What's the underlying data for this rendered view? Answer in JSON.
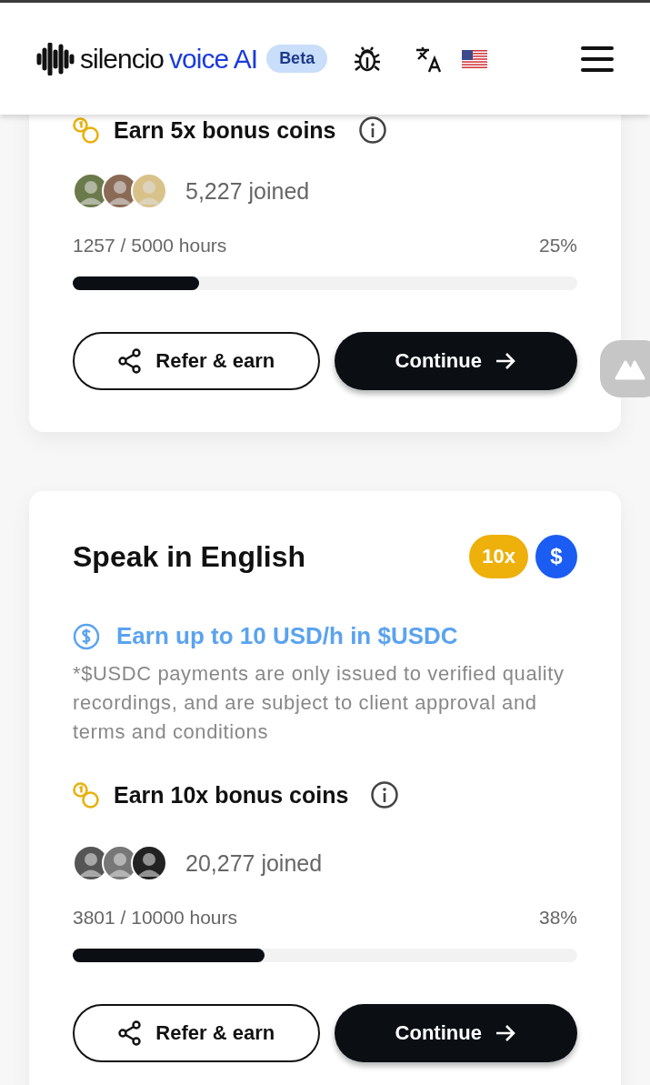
{
  "header": {
    "logo": "silencio",
    "logo_accent": "voice AI",
    "badge": "Beta"
  },
  "cards": [
    {
      "bonus": "Earn 5x bonus coins",
      "avatars": [
        {
          "kind": "picture"
        },
        {
          "kind": "picture"
        },
        {
          "kind": "picture"
        }
      ],
      "joined": "5,227 joined",
      "progress": "1257 / 5000 hours",
      "percent": "25%",
      "level": 0.25,
      "refer": "Refer & earn",
      "continue": "Continue"
    },
    {
      "title": "Speak in English",
      "multiplier": "10x",
      "currency": "$",
      "usdc": "Earn up to 10 USD/h in $USDC",
      "disclaimer": "*$USDC payments are only issued to verified quality recordings, and are subject to client approval and terms and conditions",
      "bonus": "Earn 10x bonus coins",
      "avatars": [
        {
          "kind": "picture"
        },
        {
          "kind": "picture"
        },
        {
          "kind": "picture"
        }
      ],
      "joined": "20,277 joined",
      "progress": "3801 / 10000 hours",
      "percent": "38%",
      "level": 0.38,
      "refer": "Refer & earn",
      "continue": "Continue"
    }
  ]
}
